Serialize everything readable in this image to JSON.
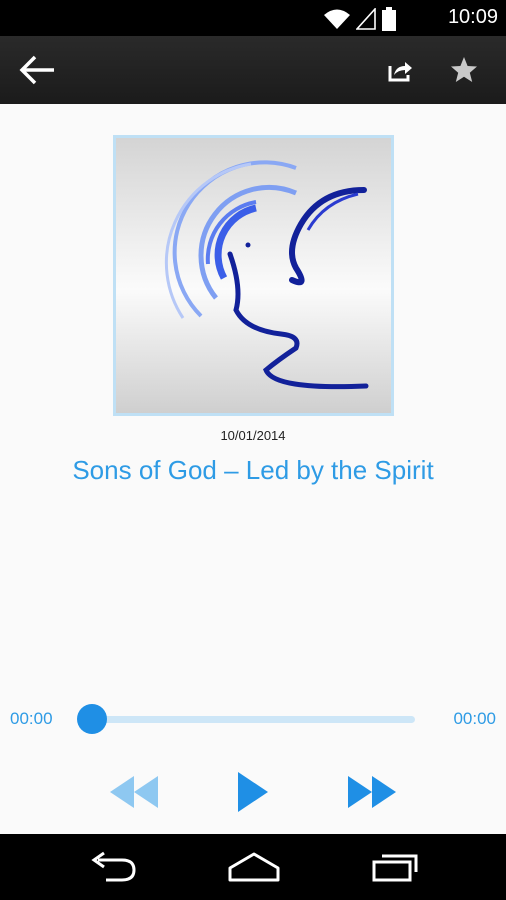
{
  "status_bar": {
    "time": "10:09",
    "icons": [
      "wifi-icon",
      "signal-icon",
      "battery-icon"
    ]
  },
  "action_bar": {
    "icons": [
      "back-arrow-icon",
      "share-icon",
      "star-icon"
    ]
  },
  "episode": {
    "date": "10/01/2014",
    "title": "Sons of God – Led by the Spirit"
  },
  "player": {
    "elapsed": "00:00",
    "duration": "00:00",
    "progress": 0,
    "icons": [
      "rewind-icon",
      "play-icon",
      "fast-forward-icon"
    ]
  },
  "nav_bar": {
    "icons": [
      "nav-back-icon",
      "home-icon",
      "recents-icon"
    ]
  },
  "colors": {
    "accent": "#2e9be5",
    "knob": "#1f8fe5",
    "track": "#cde6f7",
    "control_light": "#8ec8f1"
  }
}
